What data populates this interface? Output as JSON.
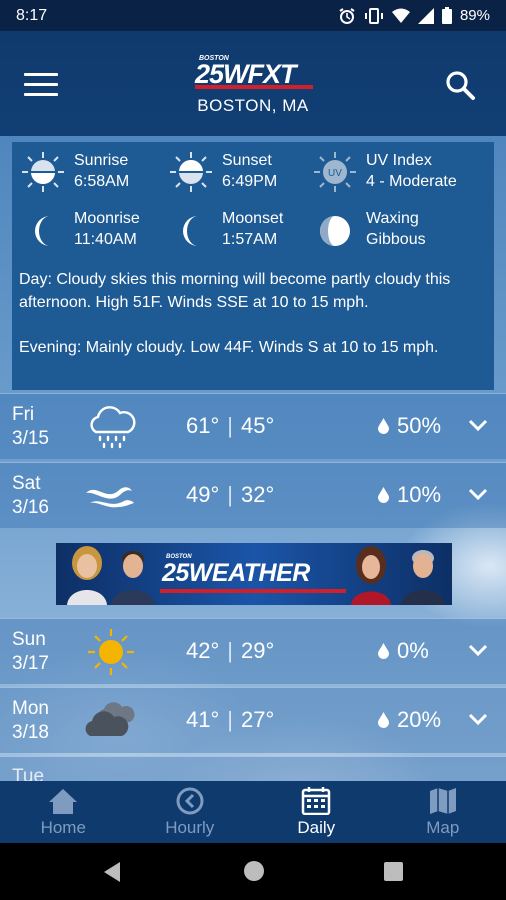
{
  "status_bar": {
    "time": "8:17",
    "battery": "89%"
  },
  "header": {
    "logo_small": "BOSTON",
    "logo_main": "25WFXT",
    "city": "BOSTON, MA"
  },
  "astro": [
    {
      "label": "Sunrise",
      "value": "6:58AM",
      "icon": "sunrise-icon"
    },
    {
      "label": "Sunset",
      "value": "6:49PM",
      "icon": "sunset-icon"
    },
    {
      "label": "UV Index",
      "value": "4 - Moderate",
      "icon": "uv-icon",
      "badge": "UV"
    },
    {
      "label": "Moonrise",
      "value": "11:40AM",
      "icon": "moonrise-icon"
    },
    {
      "label": "Moonset",
      "value": "1:57AM",
      "icon": "moonset-icon"
    },
    {
      "label": "Waxing",
      "value": "Gibbous",
      "icon": "moon-phase-icon"
    }
  ],
  "description": {
    "day": "Day: Cloudy skies this morning will become partly cloudy this afternoon. High 51F. Winds SSE at 10 to 15 mph.",
    "evening": "Evening: Mainly cloudy. Low 44F. Winds S at 10 to 15 mph."
  },
  "days": [
    {
      "dow": "Fri",
      "date": "3/15",
      "high": "61°",
      "low": "45°",
      "precip": "50%",
      "icon": "rain-cloud-icon"
    },
    {
      "dow": "Sat",
      "date": "3/16",
      "high": "49°",
      "low": "32°",
      "precip": "10%",
      "icon": "wind-icon"
    },
    {
      "dow": "Sun",
      "date": "3/17",
      "high": "42°",
      "low": "29°",
      "precip": "0%",
      "icon": "sun-icon"
    },
    {
      "dow": "Mon",
      "date": "3/18",
      "high": "41°",
      "low": "27°",
      "precip": "20%",
      "icon": "cloudy-icon"
    }
  ],
  "partial_day": "Tue",
  "ad": {
    "small": "BOSTON",
    "title": "25WEATHER"
  },
  "temp_separator": "|",
  "nav": [
    {
      "label": "Home",
      "icon": "home-icon",
      "active": false
    },
    {
      "label": "Hourly",
      "icon": "clock-icon",
      "active": false
    },
    {
      "label": "Daily",
      "icon": "calendar-icon",
      "active": true
    },
    {
      "label": "Map",
      "icon": "map-icon",
      "active": false
    }
  ],
  "colors": {
    "header": "#0f3a6e",
    "panel": "#1e5a93",
    "accent_red": "#d21f2a",
    "sun": "#f5b400"
  }
}
